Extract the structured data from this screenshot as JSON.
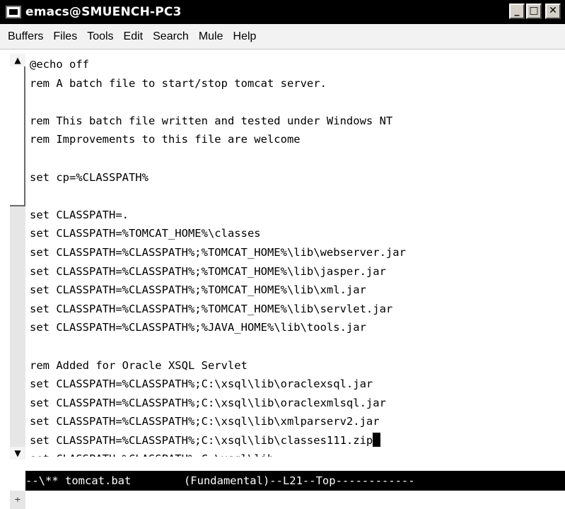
{
  "window": {
    "title": "emacs@SMUENCH-PC3",
    "minimize_glyph": "_",
    "maximize_glyph": "□",
    "close_glyph": "✕"
  },
  "menu": [
    "Buffers",
    "Files",
    "Tools",
    "Edit",
    "Search",
    "Mule",
    "Help"
  ],
  "editor": {
    "lines": [
      "@echo off",
      "rem A batch file to start/stop tomcat server.",
      "",
      "rem This batch file written and tested under Windows NT",
      "rem Improvements to this file are welcome",
      "",
      "set cp=%CLASSPATH%",
      "",
      "set CLASSPATH=.",
      "set CLASSPATH=%TOMCAT_HOME%\\classes",
      "set CLASSPATH=%CLASSPATH%;%TOMCAT_HOME%\\lib\\webserver.jar",
      "set CLASSPATH=%CLASSPATH%;%TOMCAT_HOME%\\lib\\jasper.jar",
      "set CLASSPATH=%CLASSPATH%;%TOMCAT_HOME%\\lib\\xml.jar",
      "set CLASSPATH=%CLASSPATH%;%TOMCAT_HOME%\\lib\\servlet.jar",
      "set CLASSPATH=%CLASSPATH%;%JAVA_HOME%\\lib\\tools.jar",
      "",
      "rem Added for Oracle XSQL Servlet",
      "set CLASSPATH=%CLASSPATH%;C:\\xsql\\lib\\oraclexsql.jar",
      "set CLASSPATH=%CLASSPATH%;C:\\xsql\\lib\\oraclexmlsql.jar",
      "set CLASSPATH=%CLASSPATH%;C:\\xsql\\lib\\xmlparserv2.jar",
      "set CLASSPATH=%CLASSPATH%;C:\\xsql\\lib\\classes111.zip",
      "set CLASSPATH=%CLASSPATH%;C:\\xsql\\lib"
    ],
    "cursor_line_index": 20
  },
  "scrollbar": {
    "up_arrow": "▲",
    "down_arrow": "▼",
    "mini_arrows": "÷"
  },
  "modeline": {
    "text": "--\\** tomcat.bat        (Fundamental)--L21--Top------------"
  }
}
